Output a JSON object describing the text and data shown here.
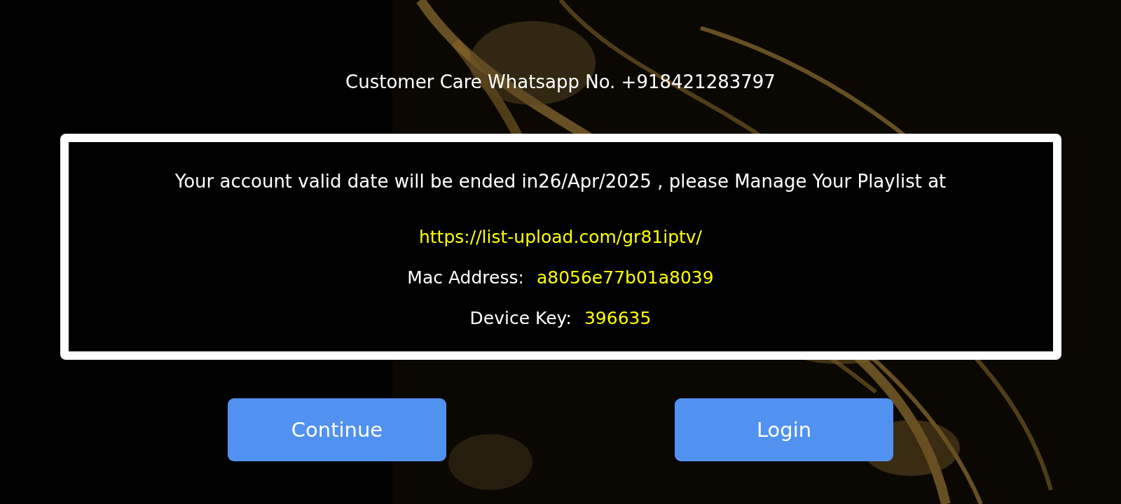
{
  "contact": "Customer Care Whatsapp No. +918421283797",
  "notice": {
    "message": "Your account valid date will be ended in26/Apr/2025 , please Manage Your Playlist at",
    "url": "https://list-upload.com/gr81iptv/",
    "fields": [
      {
        "label": "Mac Address:",
        "value": "a8056e77b01a8039"
      },
      {
        "label": "Device Key:",
        "value": "396635"
      }
    ]
  },
  "buttons": [
    {
      "label": "Continue"
    },
    {
      "label": "Login"
    }
  ]
}
